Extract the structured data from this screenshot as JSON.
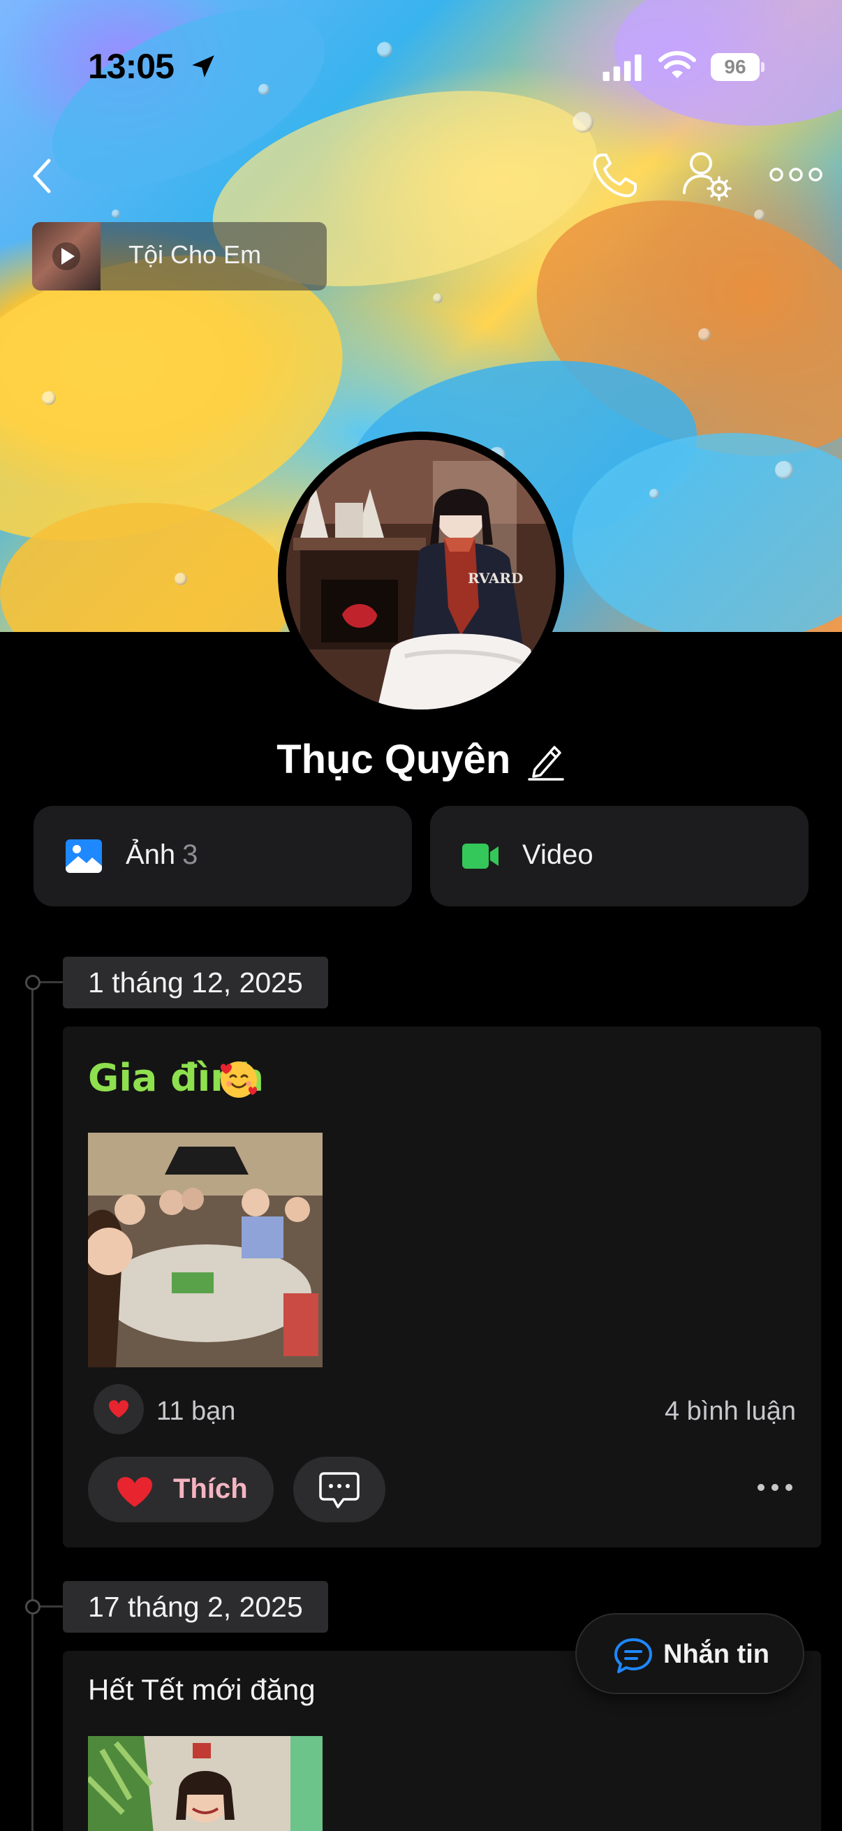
{
  "status_bar": {
    "time": "13:05",
    "battery": "96",
    "icons": [
      "location-arrow-icon",
      "cellular-signal-icon",
      "wifi-icon",
      "battery-icon"
    ]
  },
  "header": {
    "icons": [
      "back-chevron-icon",
      "phone-call-icon",
      "user-settings-icon",
      "more-dots-icon"
    ]
  },
  "music": {
    "title": "Tội Cho Em"
  },
  "profile": {
    "name": "Thục Quyên"
  },
  "media_tabs": {
    "photos_label": "Ảnh",
    "photos_count": "3",
    "videos_label": "Video"
  },
  "timeline": {
    "posts": [
      {
        "date": "1 tháng 12, 2025",
        "caption": "Gia đình",
        "reaction_count": "11 bạn",
        "comment_count": "4 bình luận",
        "like_label": "Thích"
      },
      {
        "date": "17 tháng 2, 2025",
        "caption": "Hết Tết mới đăng"
      }
    ]
  },
  "message_button": {
    "label": "Nhắn tin"
  },
  "colors": {
    "background": "#000000",
    "card": "#141414",
    "chip": "#2c2c2e",
    "caption_green": "#8ee04e",
    "like_pink": "#f5b4c1",
    "heart_red": "#e8242f",
    "accent_blue": "#1e88ff",
    "video_green": "#34c759"
  }
}
